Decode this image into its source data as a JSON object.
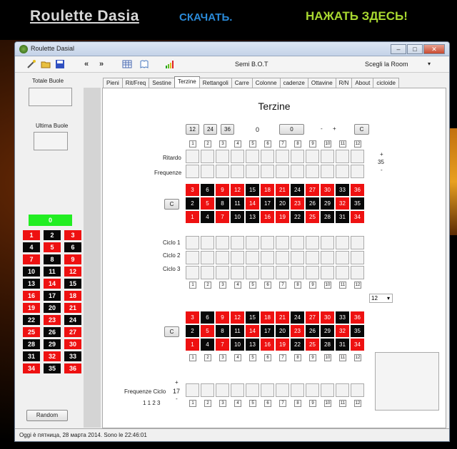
{
  "banner": {
    "title": "Roulette  Dasia",
    "download": "СКАЧАТЬ.",
    "click_here": "НАЖАТЬ ЗДЕСЬ!"
  },
  "window": {
    "title": "Roulette Dasial",
    "minimize": "–",
    "maximize": "□",
    "close": "✕"
  },
  "toolbar": {
    "semi_bot": "Semi  B.O.T",
    "room": "Scegli la Room",
    "prev": "«",
    "next": "»"
  },
  "left": {
    "totale_label": "Totale Buole",
    "ultima_label": "Ultima Buole",
    "zero": "0",
    "random_button": "Random",
    "grid": [
      {
        "n": "1",
        "c": "r"
      },
      {
        "n": "2",
        "c": "b"
      },
      {
        "n": "3",
        "c": "r"
      },
      {
        "n": "4",
        "c": "b"
      },
      {
        "n": "5",
        "c": "r"
      },
      {
        "n": "6",
        "c": "b"
      },
      {
        "n": "7",
        "c": "r"
      },
      {
        "n": "8",
        "c": "b"
      },
      {
        "n": "9",
        "c": "r"
      },
      {
        "n": "10",
        "c": "b"
      },
      {
        "n": "11",
        "c": "b"
      },
      {
        "n": "12",
        "c": "r"
      },
      {
        "n": "13",
        "c": "b"
      },
      {
        "n": "14",
        "c": "r"
      },
      {
        "n": "15",
        "c": "b"
      },
      {
        "n": "16",
        "c": "r"
      },
      {
        "n": "17",
        "c": "b"
      },
      {
        "n": "18",
        "c": "r"
      },
      {
        "n": "19",
        "c": "r"
      },
      {
        "n": "20",
        "c": "b"
      },
      {
        "n": "21",
        "c": "r"
      },
      {
        "n": "22",
        "c": "b"
      },
      {
        "n": "23",
        "c": "r"
      },
      {
        "n": "24",
        "c": "b"
      },
      {
        "n": "25",
        "c": "r"
      },
      {
        "n": "26",
        "c": "b"
      },
      {
        "n": "27",
        "c": "r"
      },
      {
        "n": "28",
        "c": "b"
      },
      {
        "n": "29",
        "c": "b"
      },
      {
        "n": "30",
        "c": "r"
      },
      {
        "n": "31",
        "c": "b"
      },
      {
        "n": "32",
        "c": "r"
      },
      {
        "n": "33",
        "c": "b"
      },
      {
        "n": "34",
        "c": "r"
      },
      {
        "n": "35",
        "c": "b"
      },
      {
        "n": "36",
        "c": "r"
      }
    ]
  },
  "tabs": [
    "Pieni",
    "Rit/Freq",
    "Sestine",
    "Terzine",
    "Rettangoli",
    "Carre",
    "Colonne",
    "cadenze",
    "Ottavine",
    "R/N",
    "About",
    "cicloide"
  ],
  "active_tab": "Terzine",
  "panel": {
    "title": "Terzine",
    "btn12": "12",
    "btn24": "24",
    "btn36": "36",
    "count": "0",
    "value": "0",
    "minus": "-",
    "plus": "+",
    "clear": "C",
    "ritardo": "Ritardo",
    "frequenze": "Frequenze",
    "plus_sign": "+",
    "counter": "35",
    "minus_sign": "-",
    "ciclo1": "Ciclo 1",
    "ciclo2": "Ciclo 2",
    "ciclo3": "Ciclo 3",
    "select_value": "12",
    "freq_ciclo": "Frequenze Ciclo",
    "freq_plus": "+",
    "freq_count": "17",
    "freq_minus": "-",
    "cycle_seq": "1 1 2 3",
    "nums": [
      "1",
      "2",
      "3",
      "4",
      "5",
      "6",
      "7",
      "8",
      "9",
      "10",
      "11",
      "12"
    ],
    "wheel": [
      {
        "n": "3",
        "c": "r"
      },
      {
        "n": "6",
        "c": "b"
      },
      {
        "n": "9",
        "c": "r"
      },
      {
        "n": "12",
        "c": "r"
      },
      {
        "n": "15",
        "c": "b"
      },
      {
        "n": "18",
        "c": "r"
      },
      {
        "n": "21",
        "c": "r"
      },
      {
        "n": "24",
        "c": "b"
      },
      {
        "n": "27",
        "c": "r"
      },
      {
        "n": "30",
        "c": "r"
      },
      {
        "n": "33",
        "c": "b"
      },
      {
        "n": "36",
        "c": "r"
      },
      {
        "n": "2",
        "c": "b"
      },
      {
        "n": "5",
        "c": "r"
      },
      {
        "n": "8",
        "c": "b"
      },
      {
        "n": "11",
        "c": "b"
      },
      {
        "n": "14",
        "c": "r"
      },
      {
        "n": "17",
        "c": "b"
      },
      {
        "n": "20",
        "c": "b"
      },
      {
        "n": "23",
        "c": "r"
      },
      {
        "n": "26",
        "c": "b"
      },
      {
        "n": "29",
        "c": "b"
      },
      {
        "n": "32",
        "c": "r"
      },
      {
        "n": "35",
        "c": "b"
      },
      {
        "n": "1",
        "c": "r"
      },
      {
        "n": "4",
        "c": "b"
      },
      {
        "n": "7",
        "c": "r"
      },
      {
        "n": "10",
        "c": "b"
      },
      {
        "n": "13",
        "c": "b"
      },
      {
        "n": "16",
        "c": "r"
      },
      {
        "n": "19",
        "c": "r"
      },
      {
        "n": "22",
        "c": "b"
      },
      {
        "n": "25",
        "c": "r"
      },
      {
        "n": "28",
        "c": "b"
      },
      {
        "n": "31",
        "c": "b"
      },
      {
        "n": "34",
        "c": "r"
      }
    ]
  },
  "status": "Oggi è пятница, 28 марта 2014. Sono le 22:46:01",
  "colors": {
    "red": "#ee1111",
    "black": "#080808",
    "green": "#22ee22"
  }
}
